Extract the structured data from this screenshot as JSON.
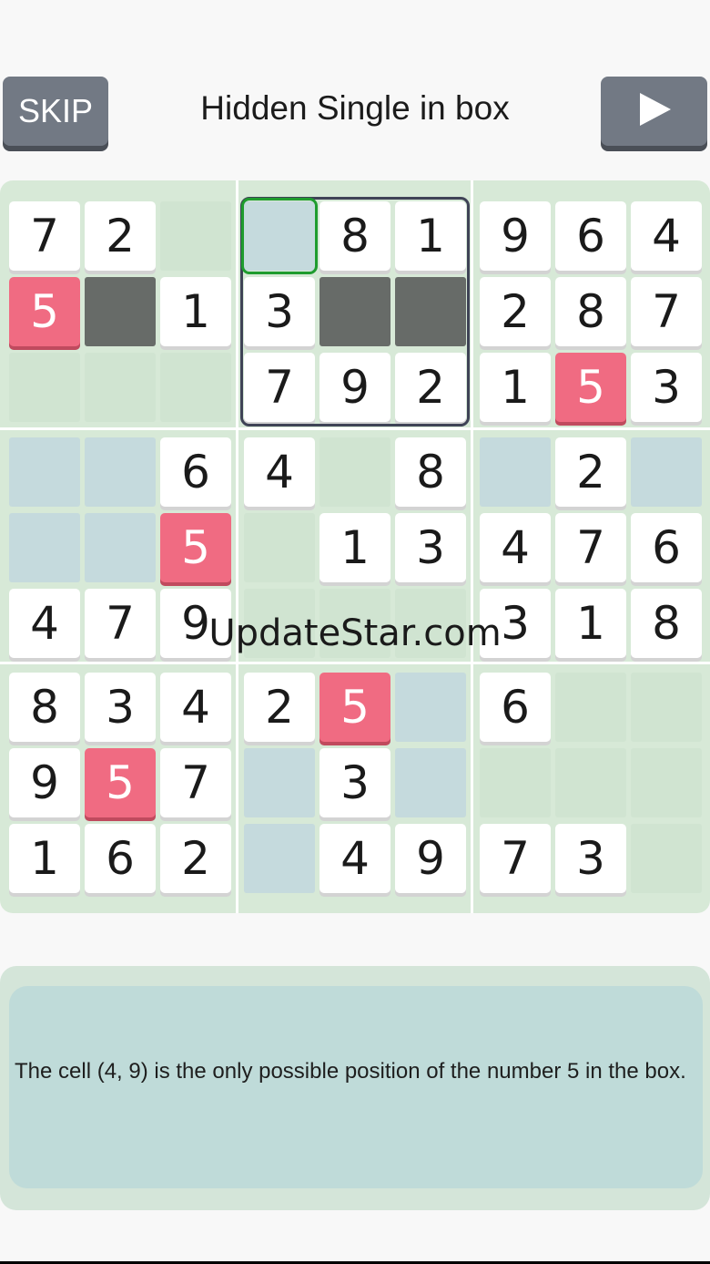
{
  "toolbar": {
    "skip_label": "SKIP",
    "title": "Hidden Single in box",
    "play_icon": "play-icon"
  },
  "colors": {
    "page_background": "#f8f8f8",
    "button_gray": "#727984",
    "board_green": "#d7e9d7",
    "empty_green": "#d0e4d1",
    "empty_blue": "#c5dadd",
    "dark_cell": "#676b68",
    "red_cell": "#f06b82",
    "box_outline": "#3f4356",
    "selected_outline": "#1f9c2e",
    "hint_background": "#bfdbd9"
  },
  "board": {
    "grid": [
      [
        "7",
        "2",
        "",
        "",
        "8",
        "1",
        "9",
        "6",
        "4"
      ],
      [
        "5",
        "",
        "1",
        "3",
        "",
        "",
        "2",
        "8",
        "7"
      ],
      [
        "",
        "",
        "",
        "7",
        "9",
        "2",
        "1",
        "5",
        "3"
      ],
      [
        "",
        "",
        "6",
        "4",
        "",
        "8",
        "",
        "2",
        ""
      ],
      [
        "",
        "",
        "5",
        "",
        "1",
        "3",
        "4",
        "7",
        "6"
      ],
      [
        "4",
        "7",
        "9",
        "",
        "",
        "",
        "3",
        "1",
        "8"
      ],
      [
        "8",
        "3",
        "4",
        "2",
        "5",
        "",
        "6",
        "",
        ""
      ],
      [
        "9",
        "5",
        "7",
        "",
        "3",
        "",
        "",
        "",
        ""
      ],
      [
        "1",
        "6",
        "2",
        "",
        "4",
        "9",
        "7",
        "3",
        ""
      ]
    ],
    "highlighted_cells": [
      [
        1,
        0
      ],
      [
        2,
        7
      ],
      [
        4,
        2
      ],
      [
        6,
        4
      ],
      [
        7,
        1
      ]
    ],
    "eliminated_cells": [
      [
        1,
        1
      ],
      [
        1,
        4
      ],
      [
        1,
        5
      ]
    ],
    "blue_cells": [
      [
        0,
        3
      ],
      [
        3,
        0
      ],
      [
        3,
        1
      ],
      [
        3,
        6
      ],
      [
        3,
        8
      ],
      [
        4,
        0
      ],
      [
        4,
        1
      ],
      [
        6,
        5
      ],
      [
        7,
        3
      ],
      [
        7,
        5
      ],
      [
        8,
        3
      ]
    ],
    "selected_cell": [
      0,
      3
    ],
    "highlighted_box": 1
  },
  "watermark": "UpdateStar.com",
  "hint": {
    "text": "The cell  (4, 9)  is the only possible position of the number 5 in the box."
  }
}
